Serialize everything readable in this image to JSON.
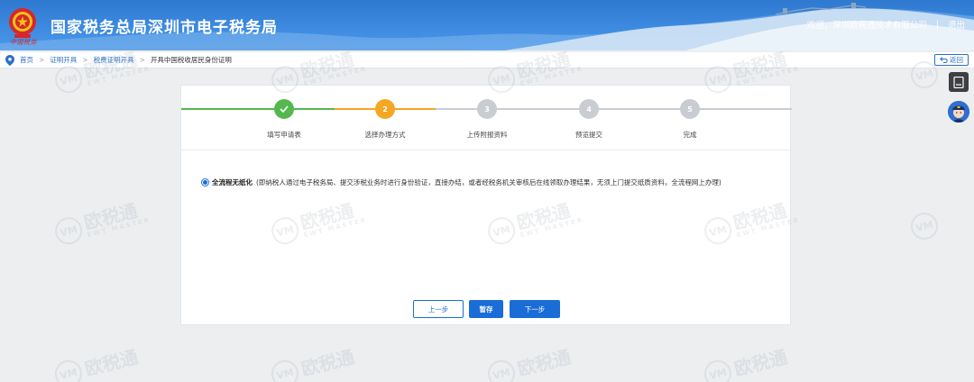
{
  "header": {
    "emblem_text": "中国税务",
    "title": "国家税务总局深圳市电子税务局",
    "welcome": "欢迎，深圳欧税通技术有限公司",
    "separator": "|",
    "logout": "退出"
  },
  "breadcrumb": {
    "items": [
      {
        "label": "首页"
      },
      {
        "label": "证明开具"
      },
      {
        "label": "税费证明开具"
      },
      {
        "label": "开具中国税收居民身份证明"
      }
    ],
    "separator": ">",
    "back_label": "返回"
  },
  "steps": [
    {
      "number": "1",
      "label": "填写申请表",
      "status": "done",
      "color": "#55b84e"
    },
    {
      "number": "2",
      "label": "选择办理方式",
      "status": "current",
      "color": "#f5a623"
    },
    {
      "number": "3",
      "label": "上传附报资料",
      "status": "todo",
      "color": "#c9cdd2"
    },
    {
      "number": "4",
      "label": "预览提交",
      "status": "todo",
      "color": "#c9cdd2"
    },
    {
      "number": "5",
      "label": "完成",
      "status": "todo",
      "color": "#c9cdd2"
    }
  ],
  "option": {
    "label": "全流程无纸化",
    "description": "(即纳税人通过电子税务局、提交涉税业务时进行身份验证，直接办结，或者经税务机关审核后在线领取办理结果，无须上门提交纸质资料，全流程网上办理)",
    "selected": true
  },
  "buttons": {
    "prev": "上一步",
    "save": "暂存",
    "next": "下一步"
  },
  "watermark": {
    "badge": "VM",
    "text": "欧税通",
    "sub": "EWT MASTER"
  },
  "colors": {
    "accent": "#1a6dd6",
    "done": "#55b84e",
    "current": "#f5a623",
    "pending": "#c9cdd2"
  }
}
